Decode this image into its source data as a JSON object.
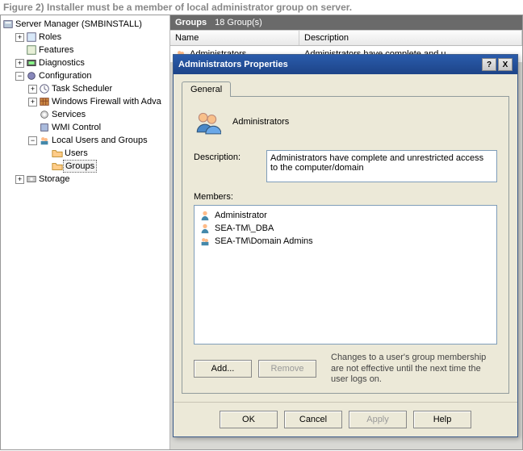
{
  "caption": "Figure 2) Installer must be a member of local administrator group on server.",
  "tree": {
    "root": "Server Manager (SMBINSTALL)",
    "roles": "Roles",
    "features": "Features",
    "diagnostics": "Diagnostics",
    "configuration": "Configuration",
    "task_scheduler": "Task Scheduler",
    "firewall": "Windows Firewall with Adva",
    "services": "Services",
    "wmi": "WMI Control",
    "lug": "Local Users and Groups",
    "users": "Users",
    "groups": "Groups",
    "storage": "Storage"
  },
  "panel": {
    "header_title": "Groups",
    "header_count": "18 Group(s)",
    "col_name": "Name",
    "col_desc": "Description",
    "row_name": "Administrators",
    "row_desc": "Administrators have complete and u..."
  },
  "dialog": {
    "title": "Administrators Properties",
    "help_btn": "?",
    "close_btn": "X",
    "tab_general": "General",
    "group_name": "Administrators",
    "desc_label": "Description:",
    "desc_value": "Administrators have complete and unrestricted access to the computer/domain",
    "members_label": "Members:",
    "members": [
      "Administrator",
      "SEA-TM\\_DBA",
      "SEA-TM\\Domain Admins"
    ],
    "add_btn": "Add...",
    "remove_btn": "Remove",
    "note": "Changes to a user's group membership are not effective until the next time the user logs on.",
    "ok_btn": "OK",
    "cancel_btn": "Cancel",
    "apply_btn": "Apply",
    "help_footer_btn": "Help"
  }
}
